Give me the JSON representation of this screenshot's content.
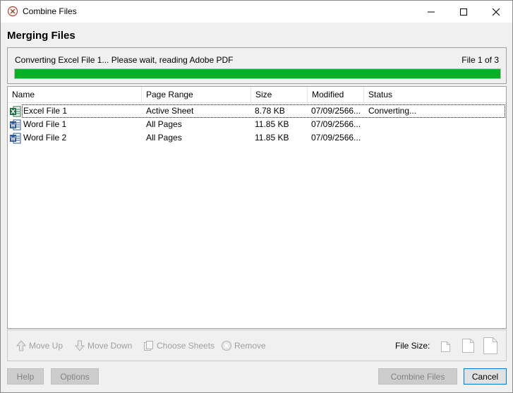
{
  "window": {
    "title": "Combine Files",
    "icons": {
      "app": "combine-files-icon",
      "minimize": "minimize-icon",
      "maximize": "maximize-icon",
      "close": "close-icon"
    }
  },
  "heading": "Merging Files",
  "progress": {
    "status_text": "Converting Excel File 1... Please wait, reading Adobe PDF",
    "count_text": "File 1 of 3",
    "fill_fraction": 1.0,
    "fill_color": "#06b025"
  },
  "columns": {
    "name": "Name",
    "page_range": "Page Range",
    "size": "Size",
    "modified": "Modified",
    "status": "Status"
  },
  "files": [
    {
      "icon": "excel-file-icon",
      "name": "Excel File 1",
      "page_range": "Active Sheet",
      "size": "8.78 KB",
      "modified": "07/09/2566...",
      "status": "Converting..."
    },
    {
      "icon": "word-file-icon",
      "name": "Word File 1",
      "page_range": "All Pages",
      "size": "11.85 KB",
      "modified": "07/09/2566...",
      "status": ""
    },
    {
      "icon": "word-file-icon",
      "name": "Word File 2",
      "page_range": "All Pages",
      "size": "11.85 KB",
      "modified": "07/09/2566...",
      "status": ""
    }
  ],
  "toolbar": {
    "move_up": "Move Up",
    "move_down": "Move Down",
    "choose_sheets": "Choose Sheets",
    "remove": "Remove",
    "file_size_label": "File Size:",
    "icons": {
      "move_up": "arrow-up-icon",
      "move_down": "arrow-down-icon",
      "choose_sheets": "sheets-icon",
      "remove": "remove-icon",
      "size_small": "document-small-icon",
      "size_medium": "document-medium-icon",
      "size_large": "document-large-icon"
    }
  },
  "buttons": {
    "help": "Help",
    "options": "Options",
    "combine": "Combine Files",
    "cancel": "Cancel"
  },
  "colors": {
    "excel_green": "#1d6f42",
    "word_blue": "#2b579a",
    "disabled_text": "#a0a0a0",
    "focus_border": "#0078d7"
  }
}
